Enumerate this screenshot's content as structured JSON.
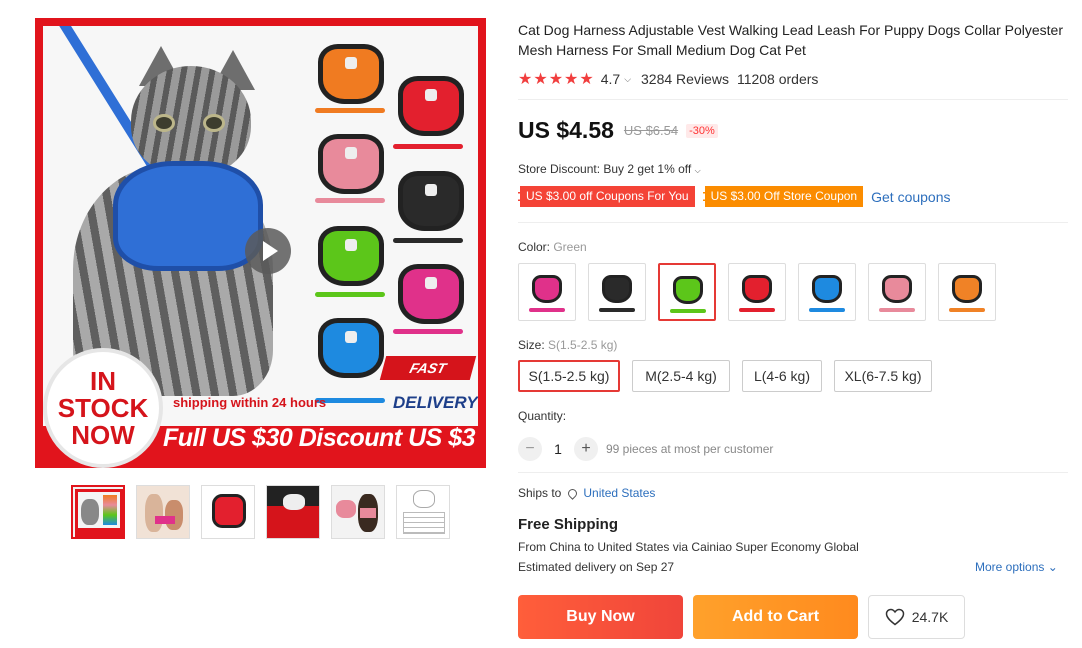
{
  "gallery": {
    "main_image_alt": "Cat wearing blue harness with colored harness samples",
    "badge_lines": [
      "IN",
      "STOCK",
      "NOW"
    ],
    "shipping_text": "shipping within 24 hours",
    "fast_text": "FAST",
    "delivery_text": "DELIVERY",
    "banner_text": "Full US $30 Discount US $3",
    "thumbnail_count": 6
  },
  "product": {
    "title": "Cat Dog Harness Adjustable Vest Walking Lead Leash For Puppy Dogs Collar Polyester Mesh Harness For Small Medium Dog Cat Pet",
    "stars": "★★★★★",
    "rating": "4.7",
    "reviews": "3284 Reviews",
    "orders": "11208 orders"
  },
  "pricing": {
    "price": "US $4.58",
    "old_price": "US $6.54",
    "discount": "-30%",
    "store_discount": "Store Discount: Buy 2 get 1% off",
    "coupon1": "US $3.00 off Coupons For You",
    "coupon2": "US $3.00 Off Store Coupon",
    "get_coupons": "Get coupons"
  },
  "color": {
    "label": "Color: ",
    "selected": "Green",
    "swatches": [
      {
        "name": "Rose",
        "color": "#e0318a"
      },
      {
        "name": "Black",
        "color": "#2a2a2a"
      },
      {
        "name": "Green",
        "color": "#5cc61a"
      },
      {
        "name": "Red",
        "color": "#e3202e"
      },
      {
        "name": "Blue",
        "color": "#1e8ae0"
      },
      {
        "name": "Pink",
        "color": "#e88a9b"
      },
      {
        "name": "Orange",
        "color": "#f08226"
      }
    ]
  },
  "size": {
    "label": "Size: ",
    "selected": "S(1.5-2.5 kg)",
    "options": [
      "S(1.5-2.5 kg)",
      "M(2.5-4 kg)",
      "L(4-6 kg)",
      "XL(6-7.5 kg)"
    ]
  },
  "quantity": {
    "label": "Quantity:",
    "minus": "−",
    "value": "1",
    "plus": "+",
    "note": "99 pieces at most per customer"
  },
  "shipping": {
    "ships_to": "Ships to",
    "country": "United States",
    "title": "Free Shipping",
    "detail": "From China to United States via Cainiao Super Economy Global",
    "delivery": "Estimated delivery on Sep 27",
    "more_options": "More options"
  },
  "actions": {
    "buy_now": "Buy Now",
    "add_to_cart": "Add to Cart",
    "wishlist_count": "24.7K"
  }
}
